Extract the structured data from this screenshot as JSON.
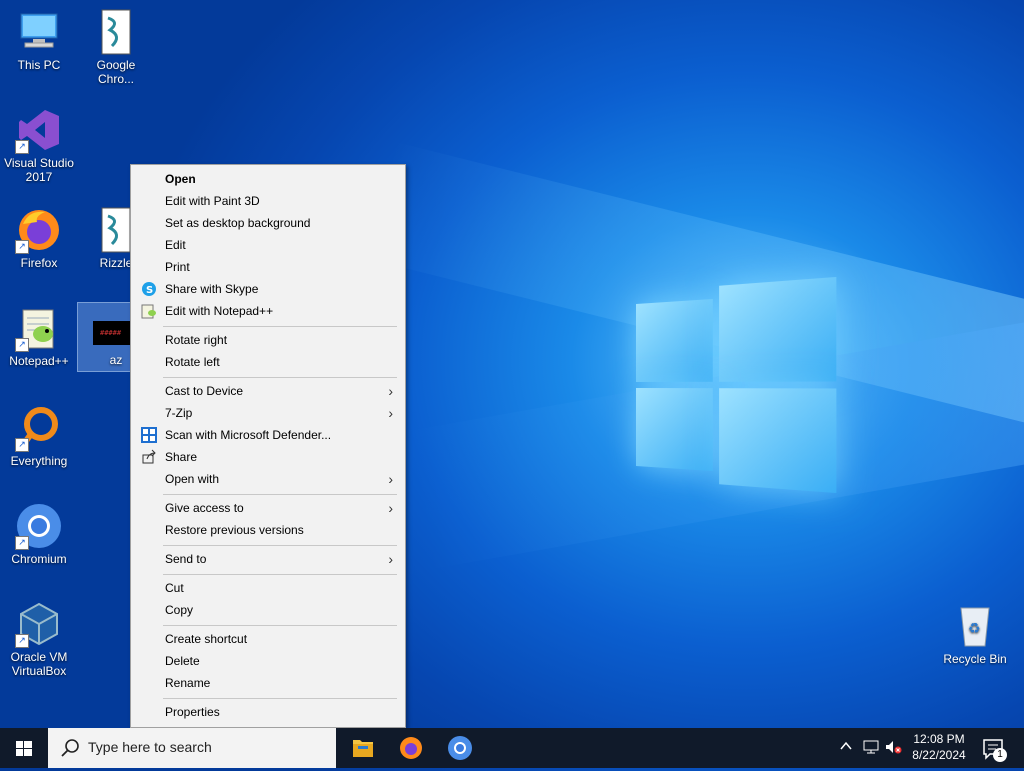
{
  "desktop": {
    "icons": [
      {
        "label": "This PC"
      },
      {
        "label": "Google Chro..."
      },
      {
        "label": "Visual Studio 2017"
      },
      {
        "label": "Firefox"
      },
      {
        "label": "Rizzle"
      },
      {
        "label": "Notepad++"
      },
      {
        "label": "az"
      },
      {
        "label": "Everything"
      },
      {
        "label": "Chromium"
      },
      {
        "label": "Oracle VM VirtualBox"
      },
      {
        "label": "Recycle Bin"
      }
    ]
  },
  "context_menu": {
    "items": [
      {
        "label": "Open"
      },
      {
        "label": "Edit with Paint 3D"
      },
      {
        "label": "Set as desktop background"
      },
      {
        "label": "Edit"
      },
      {
        "label": "Print"
      },
      {
        "label": "Share with Skype"
      },
      {
        "label": "Edit with Notepad++"
      },
      {
        "label": "Rotate right"
      },
      {
        "label": "Rotate left"
      },
      {
        "label": "Cast to Device"
      },
      {
        "label": "7-Zip"
      },
      {
        "label": "Scan with Microsoft Defender..."
      },
      {
        "label": "Share"
      },
      {
        "label": "Open with"
      },
      {
        "label": "Give access to"
      },
      {
        "label": "Restore previous versions"
      },
      {
        "label": "Send to"
      },
      {
        "label": "Cut"
      },
      {
        "label": "Copy"
      },
      {
        "label": "Create shortcut"
      },
      {
        "label": "Delete"
      },
      {
        "label": "Rename"
      },
      {
        "label": "Properties"
      }
    ],
    "submenu_arrow": "›"
  },
  "taskbar": {
    "search_placeholder": "Type here to search",
    "clock_time": "12:08 PM",
    "clock_date": "8/22/2024",
    "notification_count": "1"
  }
}
